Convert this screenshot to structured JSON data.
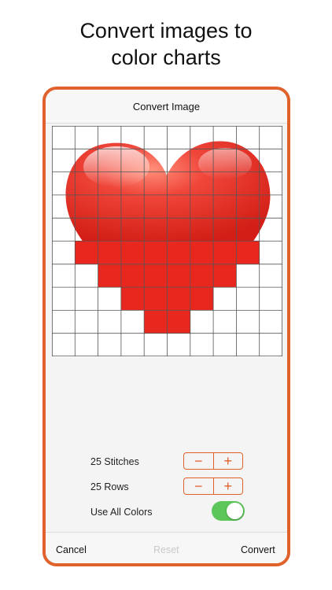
{
  "headline": {
    "line1": "Convert images to",
    "line2": "color charts"
  },
  "dialog": {
    "title": "Convert Image",
    "grid": {
      "columns": 10,
      "rows": 10,
      "image": "red-heart"
    },
    "stitches": {
      "label": "25 Stitches",
      "minus": "−",
      "plus": "+"
    },
    "rows": {
      "label": "25 Rows",
      "minus": "−",
      "plus": "+"
    },
    "use_all_colors": {
      "label": "Use All Colors",
      "on": true
    },
    "footer": {
      "cancel": "Cancel",
      "reset": "Reset",
      "convert": "Convert"
    }
  },
  "colors": {
    "accent": "#e0622a",
    "toggle_on": "#5cc65a",
    "heart": "#e8281f",
    "disabled_text": "#c8c8c8"
  }
}
